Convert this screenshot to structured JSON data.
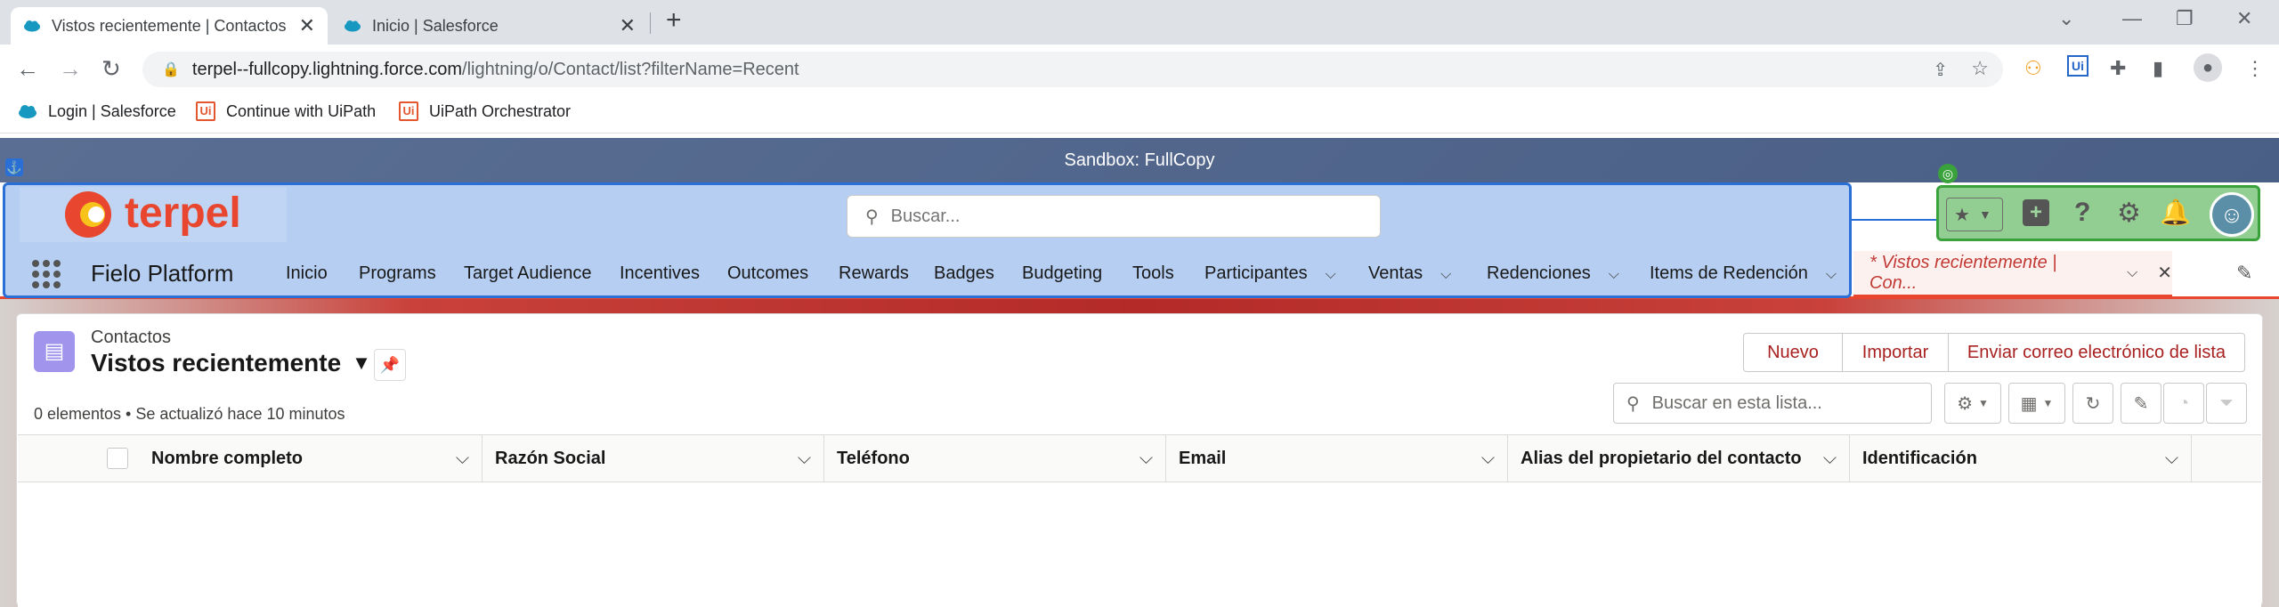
{
  "browser": {
    "tabs": [
      {
        "title": "Vistos recientemente | Contactos",
        "active": true
      },
      {
        "title": "Inicio | Salesforce",
        "active": false
      }
    ],
    "url_host": "terpel--fullcopy.lightning.force.com",
    "url_path": "/lightning/o/Contact/list?filterName=Recent",
    "bookmarks": [
      {
        "label": "Login | Salesforce",
        "icon": "salesforce-cloud-icon"
      },
      {
        "label": "Continue with UiPath",
        "icon": "uipath-icon"
      },
      {
        "label": "UiPath Orchestrator",
        "icon": "uipath-icon"
      }
    ]
  },
  "salesforce": {
    "sandbox_banner": "Sandbox: FullCopy",
    "logo_text": "terpel",
    "search_placeholder": "Buscar...",
    "app_name": "Fielo Platform",
    "nav_items": [
      {
        "label": "Inicio"
      },
      {
        "label": "Programs"
      },
      {
        "label": "Target Audience"
      },
      {
        "label": "Incentives"
      },
      {
        "label": "Outcomes"
      },
      {
        "label": "Rewards"
      },
      {
        "label": "Badges"
      },
      {
        "label": "Budgeting"
      },
      {
        "label": "Tools"
      },
      {
        "label": "Participantes"
      },
      {
        "label": "Ventas"
      },
      {
        "label": "Redenciones"
      },
      {
        "label": "Items de Redención"
      }
    ],
    "active_tab": "* Vistos recientemente | Con...",
    "list": {
      "object_label": "Contactos",
      "view_name": "Vistos recientemente",
      "status": "0 elementos • Se actualizó hace 10 minutos",
      "actions": [
        "Nuevo",
        "Importar",
        "Enviar correo electrónico de lista"
      ],
      "search_placeholder": "Buscar en esta lista...",
      "columns": [
        "Nombre completo",
        "Razón Social",
        "Teléfono",
        "Email",
        "Alias del propietario del contacto",
        "Identificación"
      ]
    }
  },
  "colors": {
    "brand_red": "#e8462e",
    "action_text": "#a82020",
    "contact_icon_bg": "#a094ed",
    "overlay_blue": "#2a6fd6",
    "overlay_green": "#3aa23a"
  }
}
